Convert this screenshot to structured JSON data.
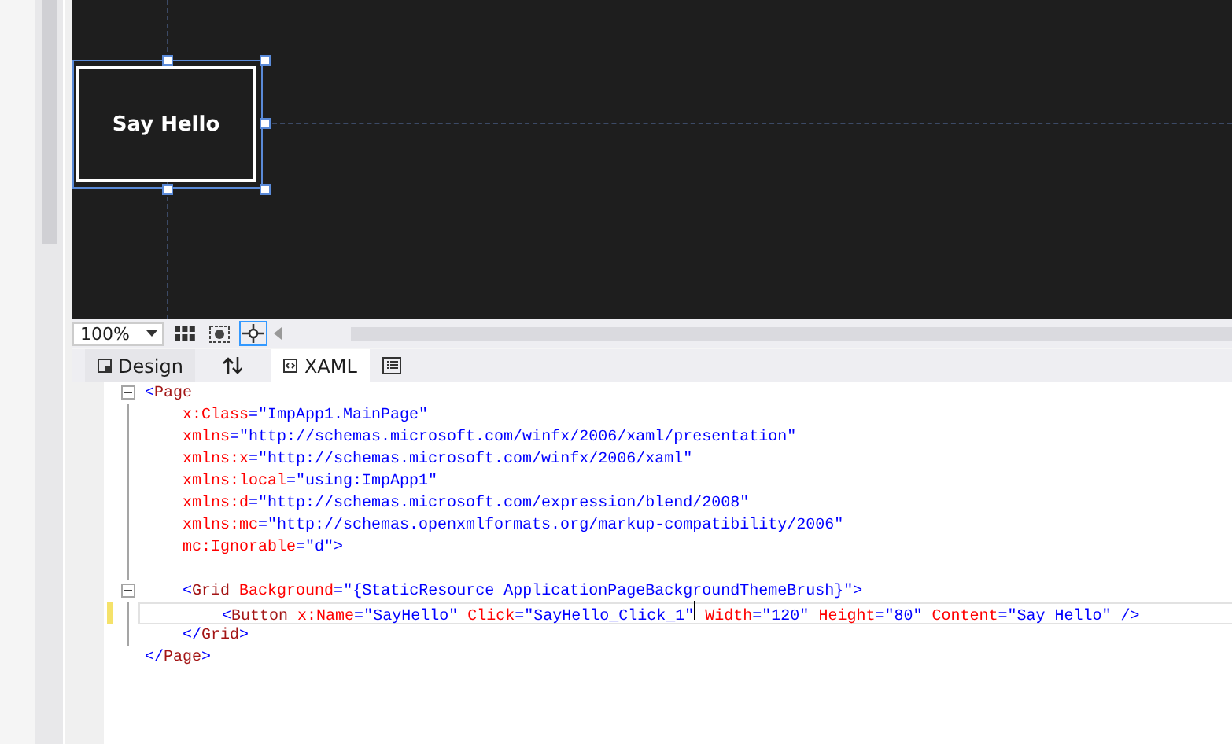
{
  "designer": {
    "button": {
      "label": "Say Hello",
      "selected": true
    }
  },
  "toolbar": {
    "zoom": "100%"
  },
  "tabs": [
    {
      "label": "Design",
      "kind": "design",
      "selected": false
    },
    {
      "kind": "swap",
      "selected": false
    },
    {
      "label": "XAML",
      "kind": "xaml",
      "selected": true
    },
    {
      "kind": "panel",
      "selected": false
    }
  ],
  "code": [
    {
      "expanded": true,
      "tokens": [
        {
          "kind": "punct",
          "text": "<"
        },
        {
          "kind": "tag",
          "text": "Page"
        }
      ],
      "children": [
        {
          "tokens": [
            {
              "kind": "attr",
              "text": "x:Class"
            },
            {
              "kind": "punct",
              "text": "="
            },
            {
              "kind": "value",
              "text": "\"ImpApp1.MainPage\""
            }
          ]
        },
        {
          "tokens": [
            {
              "kind": "attr",
              "text": "xmlns"
            },
            {
              "kind": "punct",
              "text": "="
            },
            {
              "kind": "value",
              "text": "\"http://schemas.microsoft.com/winfx/2006/xaml/presentation\""
            }
          ]
        },
        {
          "tokens": [
            {
              "kind": "attr",
              "text": "xmlns:x"
            },
            {
              "kind": "punct",
              "text": "="
            },
            {
              "kind": "value",
              "text": "\"http://schemas.microsoft.com/winfx/2006/xaml\""
            }
          ]
        },
        {
          "tokens": [
            {
              "kind": "attr",
              "text": "xmlns:local"
            },
            {
              "kind": "punct",
              "text": "="
            },
            {
              "kind": "value",
              "text": "\"using:ImpApp1\""
            }
          ]
        },
        {
          "tokens": [
            {
              "kind": "attr",
              "text": "xmlns:d"
            },
            {
              "kind": "punct",
              "text": "="
            },
            {
              "kind": "value",
              "text": "\"http://schemas.microsoft.com/expression/blend/2008\""
            }
          ]
        },
        {
          "tokens": [
            {
              "kind": "attr",
              "text": "xmlns:mc"
            },
            {
              "kind": "punct",
              "text": "="
            },
            {
              "kind": "value",
              "text": "\"http://schemas.openxmlformats.org/markup-compatibility/2006\""
            }
          ]
        },
        {
          "tokens": [
            {
              "kind": "attr",
              "text": "mc:Ignorable"
            },
            {
              "kind": "punct",
              "text": "="
            },
            {
              "kind": "value",
              "text": "\"d\""
            },
            {
              "kind": "punct",
              "text": ">"
            }
          ]
        },
        {
          "kind": "blank"
        },
        {
          "expanded": true,
          "tokens": [
            {
              "kind": "punct",
              "text": "<"
            },
            {
              "kind": "tag",
              "text": "Grid"
            },
            {
              "kind": "attr",
              "text": " Background"
            },
            {
              "kind": "punct",
              "text": "="
            },
            {
              "kind": "value",
              "text": "\"{StaticResource ApplicationPageBackgroundThemeBrush}\""
            },
            {
              "kind": "punct",
              "text": ">"
            }
          ],
          "children": [
            {
              "current": true,
              "changed": true,
              "tokens": [
                {
                  "kind": "punct",
                  "text": "<"
                },
                {
                  "kind": "tag",
                  "text": "Button"
                },
                {
                  "kind": "attr",
                  "text": " x:Name"
                },
                {
                  "kind": "punct",
                  "text": "="
                },
                {
                  "kind": "value",
                  "text": "\"SayHello\""
                },
                {
                  "kind": "attr",
                  "text": " Click"
                },
                {
                  "kind": "punct",
                  "text": "="
                },
                {
                  "kind": "value",
                  "text": "\"SayHello_Click_1\""
                },
                {
                  "kind": "attr",
                  "text": " Width"
                },
                {
                  "kind": "punct",
                  "text": "="
                },
                {
                  "kind": "value",
                  "text": "\"120\""
                },
                {
                  "kind": "attr",
                  "text": " Height"
                },
                {
                  "kind": "punct",
                  "text": "="
                },
                {
                  "kind": "value",
                  "text": "\"80\""
                },
                {
                  "kind": "attr",
                  "text": " Content"
                },
                {
                  "kind": "punct",
                  "text": "="
                },
                {
                  "kind": "value",
                  "text": "\"Say Hello\""
                },
                {
                  "kind": "punct",
                  "text": " />"
                }
              ]
            }
          ]
        },
        {
          "tokens": [
            {
              "kind": "punct",
              "text": "</"
            },
            {
              "kind": "tag",
              "text": "Grid"
            },
            {
              "kind": "punct",
              "text": ">"
            }
          ]
        }
      ]
    },
    {
      "tokens": [
        {
          "kind": "punct",
          "text": "</"
        },
        {
          "kind": "tag",
          "text": "Page"
        },
        {
          "kind": "punct",
          "text": ">"
        }
      ]
    }
  ]
}
